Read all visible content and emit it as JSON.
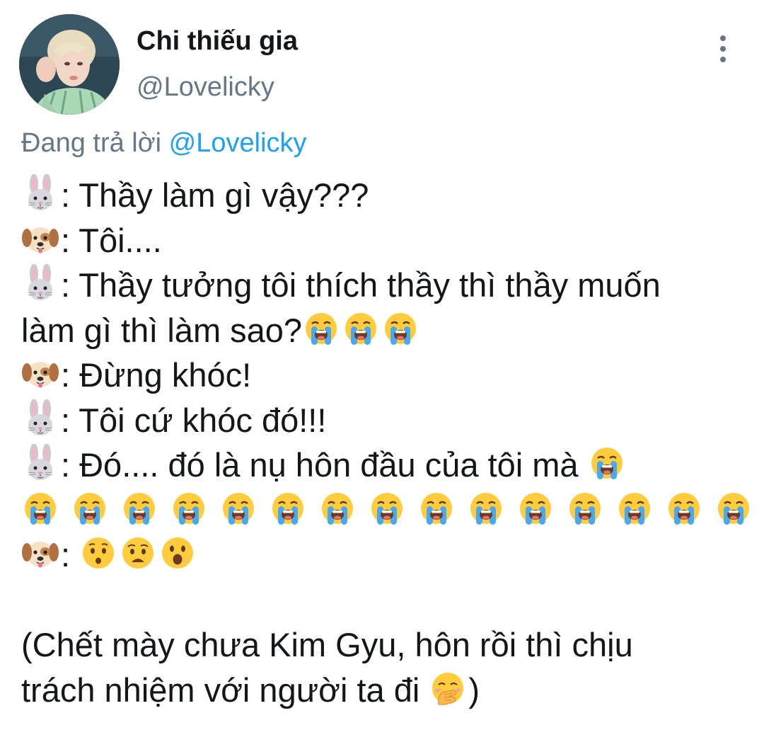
{
  "tweet": {
    "display_name": "Chi thiếu gia",
    "handle": "@Lovelicky",
    "reply_prefix": "Đang trả lời",
    "reply_to": "@Lovelicky",
    "menu_icon": "more-vertical-icon",
    "avatar": "profile-photo",
    "lines": [
      {
        "icon": "rabbit-face",
        "text": ": Thầy làm gì vậy???"
      },
      {
        "icon": "dog-face",
        "text": ": Tôi...."
      },
      {
        "icon": "rabbit-face",
        "text": ": Thầy tưởng tôi thích thầy thì thầy muốn"
      },
      {
        "text": "làm gì thì làm sao?",
        "trailing_icons": [
          "loudly-crying-face",
          "loudly-crying-face",
          "loudly-crying-face"
        ]
      },
      {
        "icon": "dog-face",
        "text": ": Đừng khóc!"
      },
      {
        "icon": "rabbit-face",
        "text": ": Tôi cứ khóc đó!!!"
      },
      {
        "icon": "rabbit-face",
        "text": ": Đó.... đó là nụ hôn đầu của tôi mà ",
        "trailing_icons": [
          "loudly-crying-face"
        ]
      },
      {
        "text": "",
        "trailing_icons": [
          "loudly-crying-face",
          "loudly-crying-face",
          "loudly-crying-face",
          "loudly-crying-face",
          "loudly-crying-face",
          "loudly-crying-face",
          "loudly-crying-face",
          "loudly-crying-face",
          "loudly-crying-face",
          "loudly-crying-face",
          "loudly-crying-face",
          "loudly-crying-face",
          "loudly-crying-face",
          "loudly-crying-face",
          "loudly-crying-face"
        ]
      },
      {
        "icon": "dog-face",
        "text": ": ",
        "trailing_icons": [
          "hushed-face",
          "anguished-face",
          "open-mouth-face"
        ]
      },
      {
        "text": ""
      },
      {
        "text": "(Chết mày chưa Kim Gyu, hôn rồi thì chịu"
      },
      {
        "text": "trách nhiệm với người ta đi ",
        "trailing_icons": [
          "face-with-hand-over-mouth"
        ],
        "after": ")"
      }
    ]
  },
  "colors": {
    "text": "#14171a",
    "secondary": "#657786",
    "link": "#1da1f2",
    "background": "#ffffff"
  }
}
